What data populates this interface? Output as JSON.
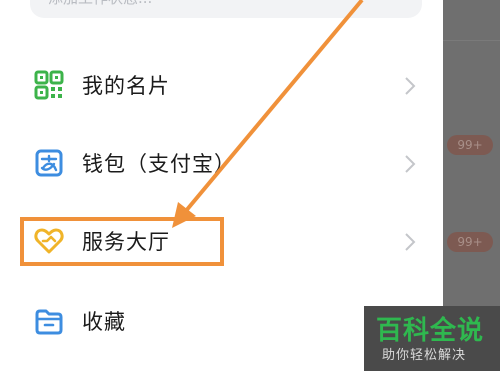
{
  "status_input": {
    "placeholder": "添加工作状态..."
  },
  "menu": {
    "items": [
      {
        "label": "我的名片",
        "icon": "qr-card-icon"
      },
      {
        "label": "钱包（支付宝）",
        "icon": "wallet-icon"
      },
      {
        "label": "服务大厅",
        "icon": "heart-service-icon",
        "highlighted": true
      },
      {
        "label": "收藏",
        "icon": "folder-icon"
      }
    ]
  },
  "background": {
    "badge_1": "99+",
    "badge_2": "99+"
  },
  "watermark": {
    "title": "百科全说",
    "subtitle": "助你轻松解决"
  },
  "colors": {
    "highlight": "#f0913a",
    "qr_icon": "#3cb34a",
    "wallet_icon": "#3d8de0",
    "service_icon": "#f0b429",
    "folder_icon": "#3d8de0",
    "watermark_green": "#2fb84f"
  }
}
